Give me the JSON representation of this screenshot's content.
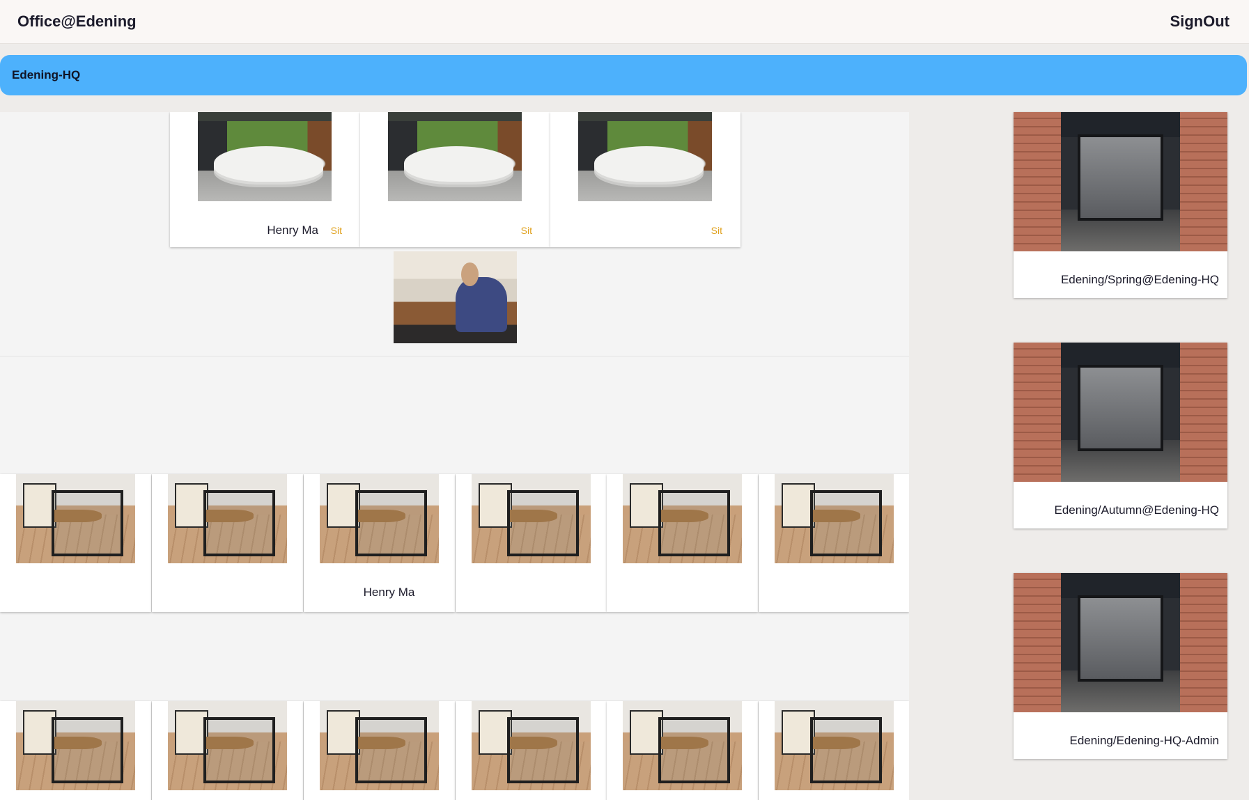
{
  "header": {
    "brand": "Office@Edening",
    "signout": "SignOut"
  },
  "location": {
    "name": "Edening-HQ"
  },
  "reception": {
    "seats": [
      {
        "name": "Henry Ma",
        "action": "Sit"
      },
      {
        "name": "",
        "action": "Sit"
      },
      {
        "name": "",
        "action": "Sit"
      }
    ]
  },
  "cubicles_row1": [
    {
      "name": ""
    },
    {
      "name": ""
    },
    {
      "name": "Henry Ma"
    },
    {
      "name": ""
    },
    {
      "name": ""
    },
    {
      "name": ""
    }
  ],
  "cubicles_row2": [
    {
      "name": ""
    },
    {
      "name": ""
    },
    {
      "name": ""
    },
    {
      "name": ""
    },
    {
      "name": ""
    },
    {
      "name": ""
    }
  ],
  "rooms": [
    {
      "label": "Edening/Spring@Edening-HQ"
    },
    {
      "label": "Edening/Autumn@Edening-HQ"
    },
    {
      "label": "Edening/Edening-HQ-Admin"
    }
  ]
}
